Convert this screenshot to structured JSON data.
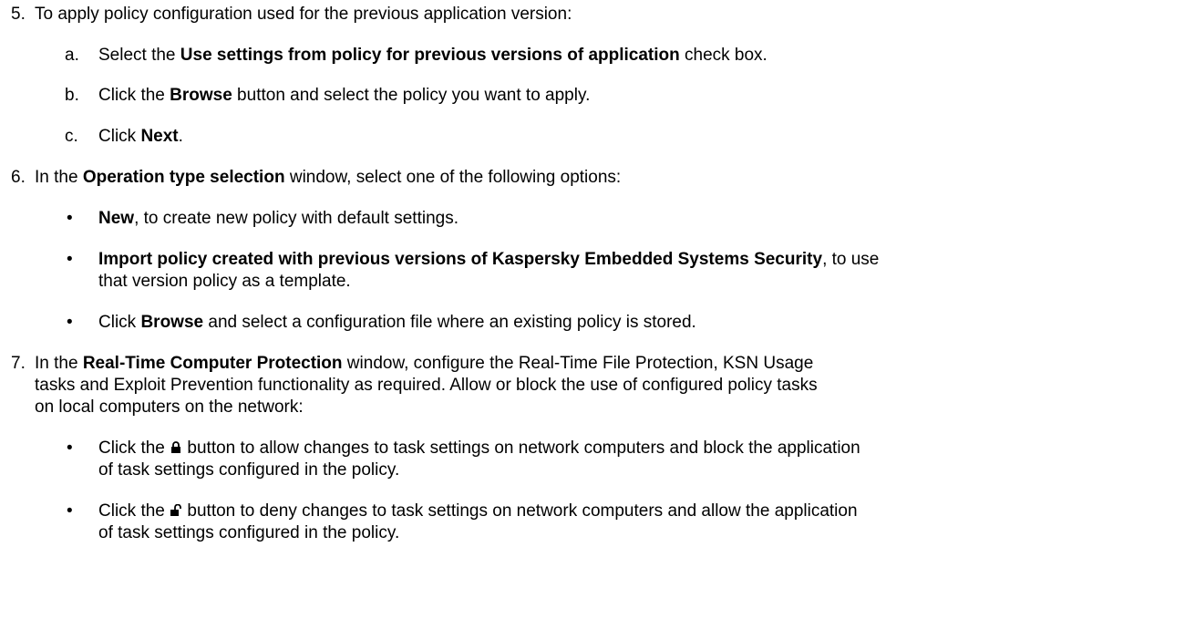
{
  "step5": {
    "num": "5.",
    "text": "To apply policy configuration used for the previous application version:",
    "a": {
      "letter": "a.",
      "pre": "Select the ",
      "bold": "Use settings from policy for previous versions of application",
      "post": " check box."
    },
    "b": {
      "letter": "b.",
      "pre": "Click the ",
      "bold": "Browse",
      "post": " button and select the policy you want to apply."
    },
    "c": {
      "letter": "c.",
      "pre": "Click ",
      "bold": "Next",
      "post": "."
    }
  },
  "step6": {
    "num": "6.",
    "pre": "In the ",
    "bold": "Operation type selection",
    "post": " window, select one of the following options:",
    "bullet1": {
      "bold": "New",
      "post": ", to create new policy with default settings."
    },
    "bullet2": {
      "bold": "Import policy created with previous versions of Kaspersky Embedded Systems Security",
      "post": ", to use",
      "line2": "that version policy as a template."
    },
    "bullet3": {
      "pre": "Click ",
      "bold": "Browse",
      "post": " and select a configuration file where an existing policy is stored."
    }
  },
  "step7": {
    "num": "7.",
    "pre": "In the ",
    "bold": "Real-Time Computer Protection",
    "post": " window, configure the Real-Time File Protection, KSN Usage",
    "line2": "tasks and Exploit Prevention functionality as required. Allow or block the use of configured policy tasks",
    "line3": "on local computers on the network:",
    "bullet1": {
      "pre": "Click the ",
      "icon": "closed-lock-icon",
      "post": " button to allow changes to task settings on network computers and block the application",
      "line2": "of task settings configured in the policy."
    },
    "bullet2": {
      "pre": "Click the ",
      "icon": "open-lock-icon",
      "post": " button to deny changes to task settings on network computers and allow the application",
      "line2": "of task settings configured in the policy."
    }
  },
  "bullet_char": "•"
}
